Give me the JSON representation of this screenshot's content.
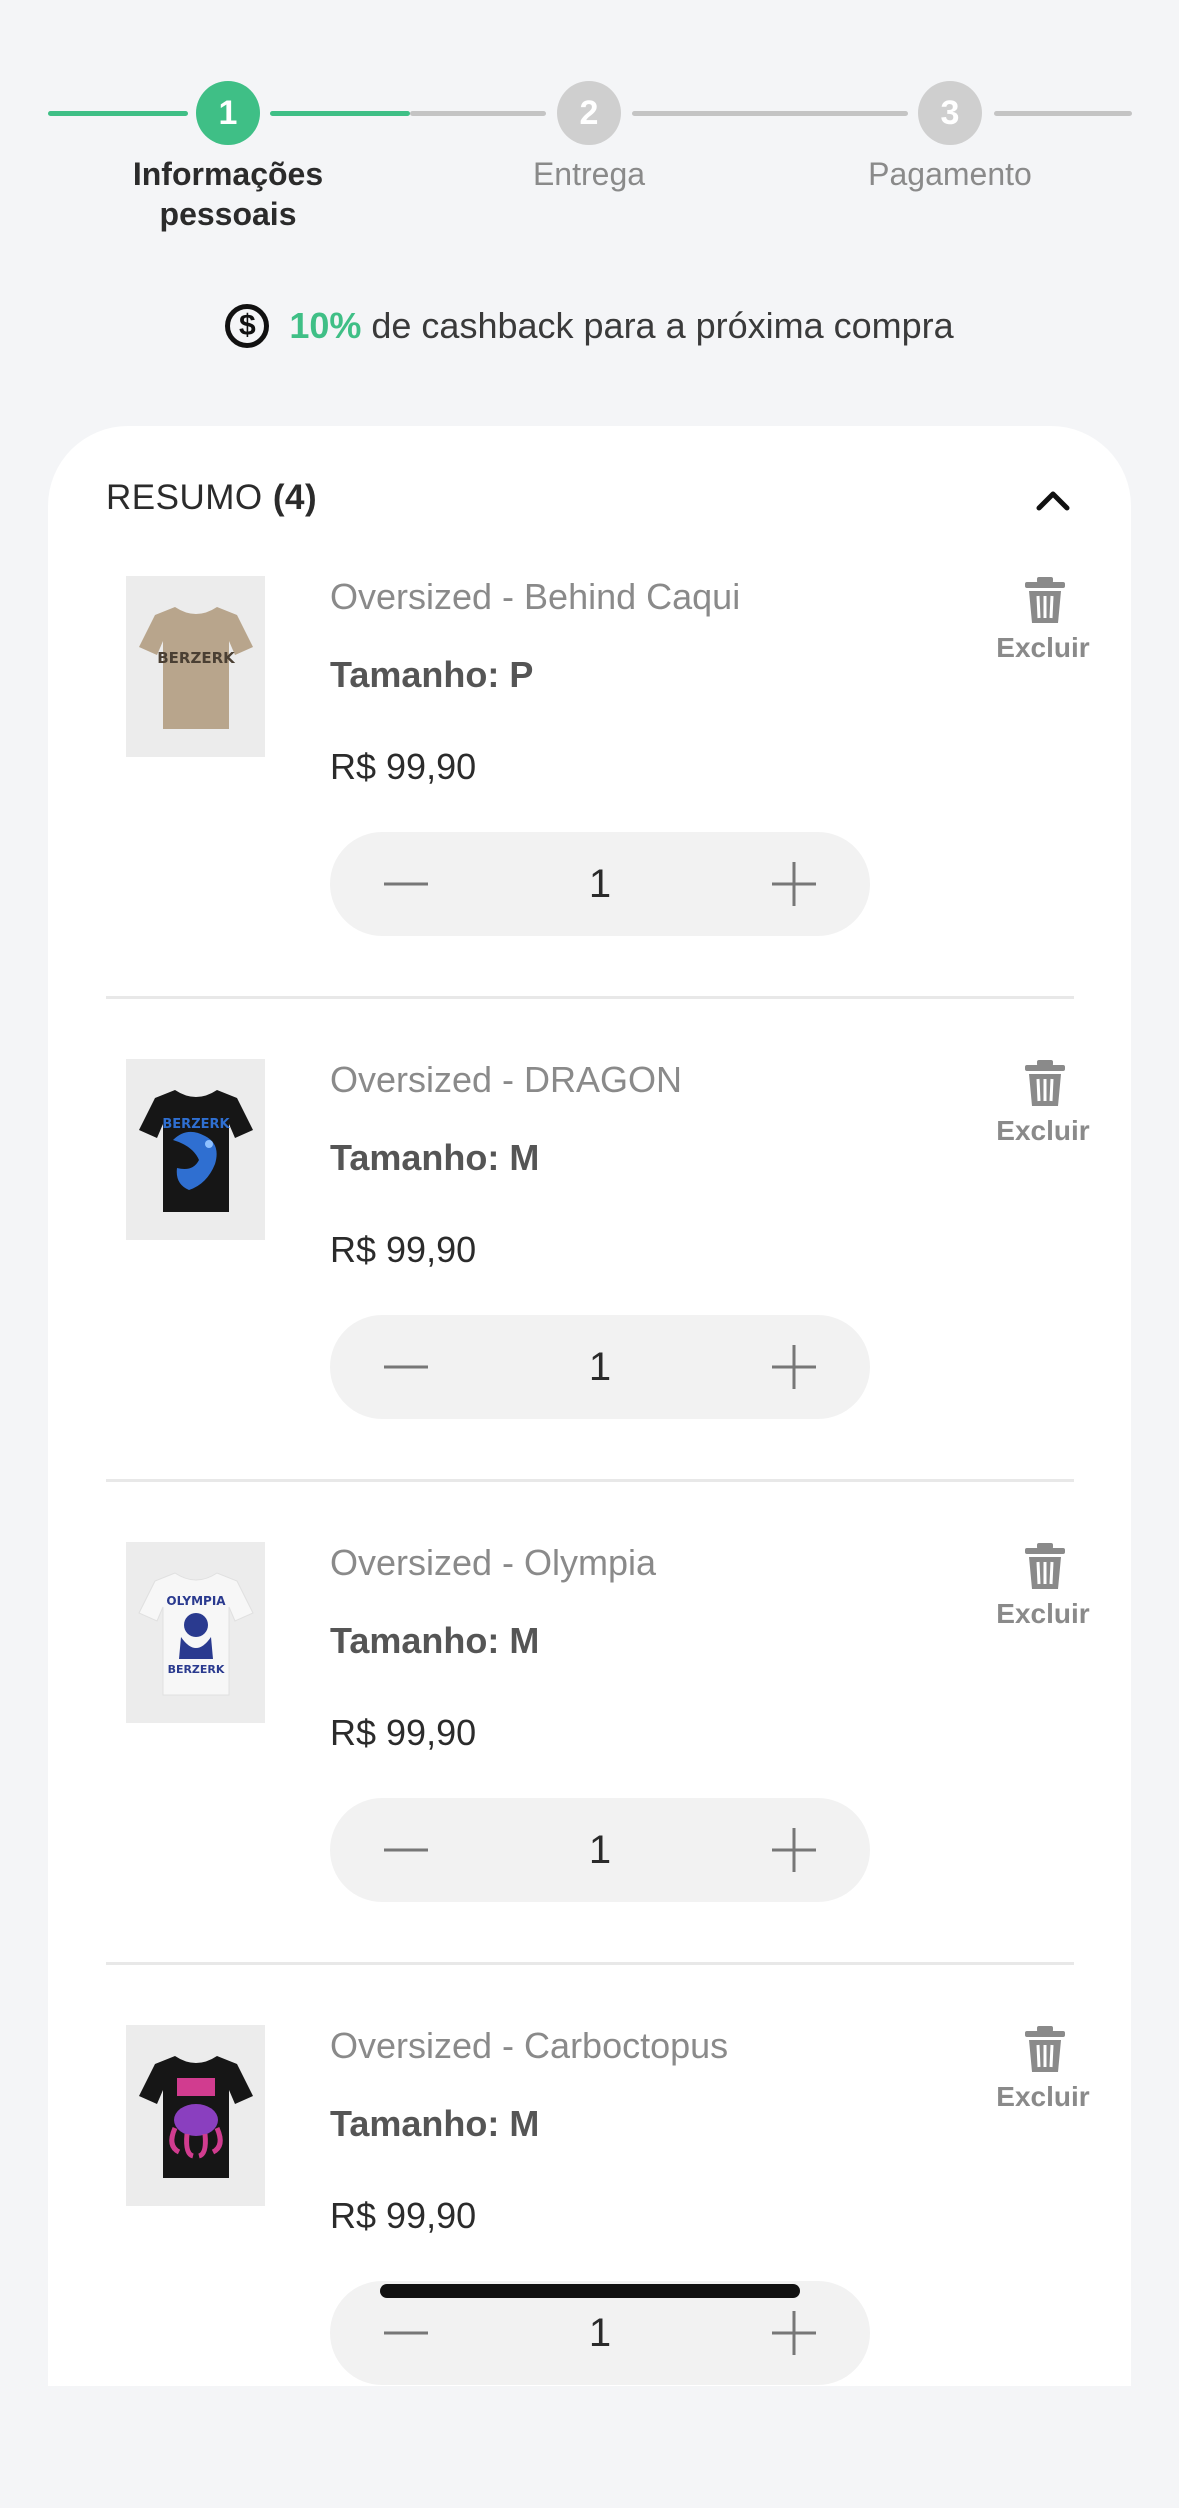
{
  "stepper": {
    "steps": [
      {
        "number": "1",
        "label_line1": "Informações",
        "label_line2": "pessoais",
        "state": "active"
      },
      {
        "number": "2",
        "label_line1": "Entrega",
        "label_line2": "",
        "state": "inactive"
      },
      {
        "number": "3",
        "label_line1": "Pagamento",
        "label_line2": "",
        "state": "inactive"
      }
    ]
  },
  "cashback": {
    "icon": "dollar-circle-icon",
    "percent": "10%",
    "text": "de cashback para a próxima compra"
  },
  "summary": {
    "label": "RESUMO",
    "count": "(4)",
    "toggle_icon": "chevron-up-icon"
  },
  "items": [
    {
      "name": "Oversized - Behind Caqui",
      "size": "Tamanho: P",
      "price": "R$ 99,90",
      "quantity": "1",
      "delete_label": "Excluir",
      "shirt_color": "#b8a58c"
    },
    {
      "name": "Oversized - DRAGON",
      "size": "Tamanho: M",
      "price": "R$ 99,90",
      "quantity": "1",
      "delete_label": "Excluir",
      "shirt_color": "#161616"
    },
    {
      "name": "Oversized - Olympia",
      "size": "Tamanho: M",
      "price": "R$ 99,90",
      "quantity": "1",
      "delete_label": "Excluir",
      "shirt_color": "#f7f7f7"
    },
    {
      "name": "Oversized - Carboctopus",
      "size": "Tamanho: M",
      "price": "R$ 99,90",
      "quantity": "1",
      "delete_label": "Excluir",
      "shirt_color": "#161616"
    }
  ],
  "colors": {
    "accent": "#3fbf86",
    "inactive": "#cfcfcf"
  }
}
